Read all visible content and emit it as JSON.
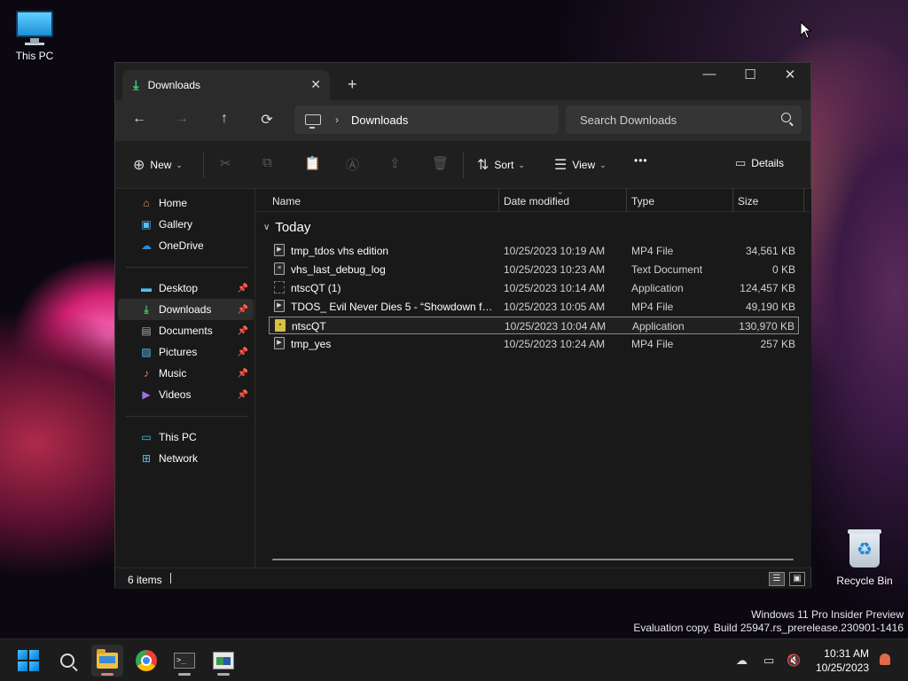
{
  "desktop": {
    "this_pc_label": "This PC",
    "recycle_bin_label": "Recycle Bin",
    "watermark_line1": "Windows 11 Pro Insider Preview",
    "watermark_line2": "Evaluation copy. Build 25947.rs_prerelease.230901-1416"
  },
  "window": {
    "tab_title": "Downloads",
    "tab_icon": "download-icon",
    "new_tab": "+",
    "close_tab": "✕",
    "minimize": "—",
    "maximize": "☐",
    "close": "✕"
  },
  "addressbar": {
    "back": "←",
    "forward": "→",
    "up": "↑",
    "refresh": "⟳",
    "breadcrumb": "Downloads",
    "search_placeholder": "Search Downloads"
  },
  "toolbar": {
    "new_label": "New",
    "sort_label": "Sort",
    "view_label": "View",
    "more_label": "•••",
    "details_label": "Details"
  },
  "sidebar": {
    "items": [
      {
        "label": "Home",
        "icon": "home-icon",
        "pinned": false
      },
      {
        "label": "Gallery",
        "icon": "gallery-icon",
        "pinned": false
      },
      {
        "label": "OneDrive",
        "icon": "onedrive-icon",
        "pinned": false
      },
      {
        "label": "Desktop",
        "icon": "desktop-icon",
        "pinned": true
      },
      {
        "label": "Downloads",
        "icon": "download-icon",
        "pinned": true,
        "active": true
      },
      {
        "label": "Documents",
        "icon": "documents-icon",
        "pinned": true
      },
      {
        "label": "Pictures",
        "icon": "pictures-icon",
        "pinned": true
      },
      {
        "label": "Music",
        "icon": "music-icon",
        "pinned": true
      },
      {
        "label": "Videos",
        "icon": "videos-icon",
        "pinned": true
      },
      {
        "label": "This PC",
        "icon": "this-pc-icon",
        "pinned": false
      },
      {
        "label": "Network",
        "icon": "network-icon",
        "pinned": false
      }
    ]
  },
  "files": {
    "columns": [
      "Name",
      "Date modified",
      "Type",
      "Size"
    ],
    "group": "Today",
    "rows": [
      {
        "name": "tmp_tdos vhs edition",
        "date": "10/25/2023 10:19 AM",
        "type": "MP4 File",
        "size": "34,561 KB",
        "icon": "video-file-icon"
      },
      {
        "name": "vhs_last_debug_log",
        "date": "10/25/2023 10:23 AM",
        "type": "Text Document",
        "size": "0 KB",
        "icon": "text-file-icon"
      },
      {
        "name": "ntscQT (1)",
        "date": "10/25/2023 10:14 AM",
        "type": "Application",
        "size": "124,457 KB",
        "icon": "app-file-icon"
      },
      {
        "name": "TDOS_ Evil Never Dies 5 - “Showdown for...",
        "date": "10/25/2023 10:05 AM",
        "type": "MP4 File",
        "size": "49,190 KB",
        "icon": "video-file-icon"
      },
      {
        "name": "ntscQT",
        "date": "10/25/2023 10:04 AM",
        "type": "Application",
        "size": "130,970 KB",
        "icon": "app-file-icon",
        "selected": true
      },
      {
        "name": "tmp_yes",
        "date": "10/25/2023 10:24 AM",
        "type": "MP4 File",
        "size": "257 KB",
        "icon": "video-file-icon"
      }
    ]
  },
  "status": {
    "item_count": "6 items"
  },
  "taskbar": {
    "time": "10:31 AM",
    "date": "10/25/2023"
  },
  "colors": {
    "accent": "#0078d4",
    "download_green": "#3fcf6c",
    "window_bg": "#191919"
  }
}
